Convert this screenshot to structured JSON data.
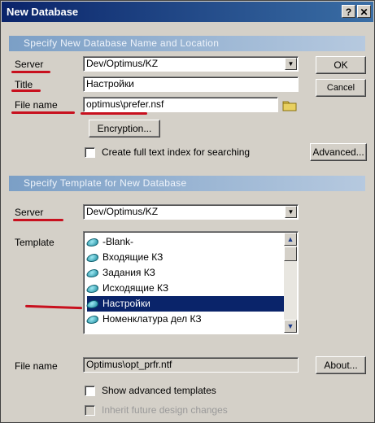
{
  "window": {
    "title": "New Database",
    "help_glyph": "?",
    "close_glyph": "✕"
  },
  "section1": {
    "header": "Specify New Database Name and Location"
  },
  "server1": {
    "label": "Server",
    "value": "Dev/Optimus/KZ"
  },
  "title": {
    "label": "Title",
    "value": "Настройки"
  },
  "filename1": {
    "label": "File name",
    "value": "optimus\\prefer.nsf"
  },
  "buttons": {
    "ok": "OK",
    "cancel": "Cancel",
    "encryption": "Encryption...",
    "advanced": "Advanced...",
    "about": "About..."
  },
  "fulltext": {
    "label": "Create full text index for searching"
  },
  "section2": {
    "header": "Specify Template for New Database"
  },
  "server2": {
    "label": "Server",
    "value": "Dev/Optimus/KZ"
  },
  "template": {
    "label": "Template",
    "items": [
      "-Blank-",
      "Входящие КЗ",
      "Задания КЗ",
      "Исходящие КЗ",
      "Настройки",
      "Номенклатура дел КЗ"
    ],
    "selected_index": 4
  },
  "filename2": {
    "label": "File name",
    "value": "Optimus\\opt_prfr.ntf"
  },
  "show_advanced": {
    "label": "Show advanced templates"
  },
  "inherit": {
    "label": "Inherit future design changes"
  },
  "colors": {
    "title_bar": "#0a246a",
    "section_header": "#7b9fc6",
    "annotation_red": "#c8101e",
    "selection": "#0a246a"
  }
}
